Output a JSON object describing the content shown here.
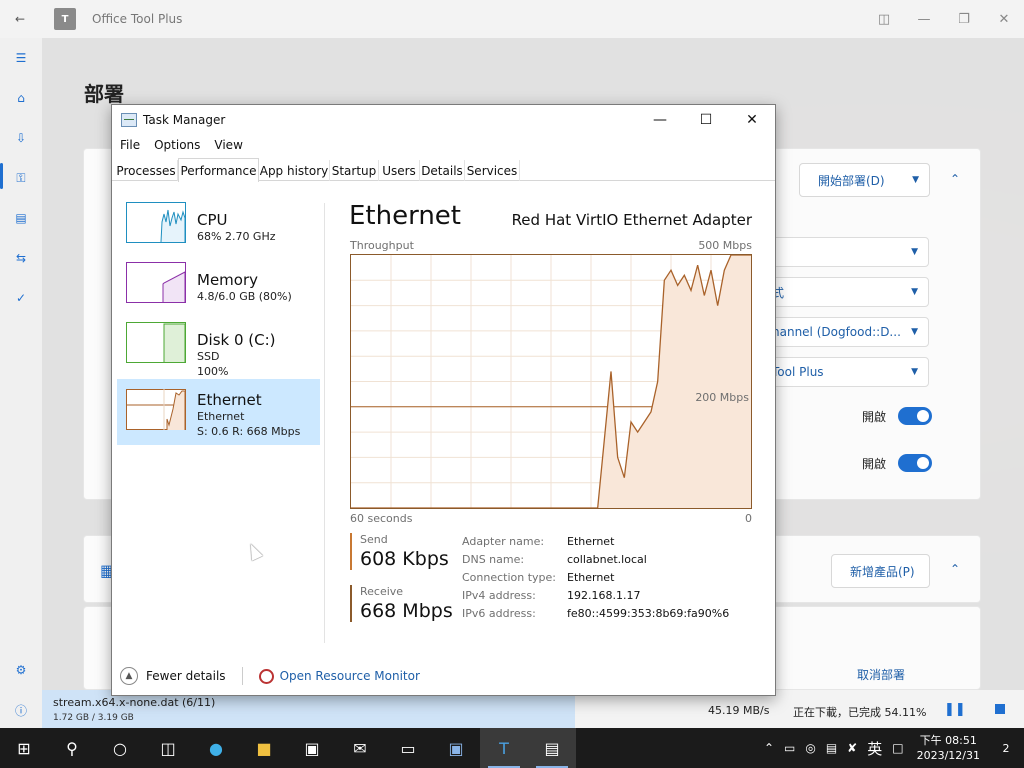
{
  "otp": {
    "title": "Office Tool Plus",
    "logo_text": "T",
    "heading": "部署",
    "deploy_button": "開始部署(D)",
    "dropdowns": [
      "",
      "式",
      "hannel (Dogfood::D...",
      "Tool Plus"
    ],
    "toggle_label": "開啟",
    "add_product_button": "新增產品(P)",
    "cancel_deploy": "取消部署",
    "status": {
      "file": "stream.x64.x-none.dat (6/11)",
      "size": "1.72 GB / 3.19 GB",
      "speed": "45.19 MB/s",
      "state": "正在下載，已完成 54.11%",
      "progress_fraction": 0.5411
    }
  },
  "taskmanager": {
    "title": "Task Manager",
    "menu": [
      "File",
      "Options",
      "View"
    ],
    "tabs": [
      "Processes",
      "Performance",
      "App history",
      "Startup",
      "Users",
      "Details",
      "Services"
    ],
    "selected_tab": "Performance",
    "sidebar": [
      {
        "name": "CPU",
        "line1": "68%  2.70 GHz",
        "line2": "",
        "color": "#1f8fc0"
      },
      {
        "name": "Memory",
        "line1": "4.8/6.0 GB (80%)",
        "line2": "",
        "color": "#8b2fa8"
      },
      {
        "name": "Disk 0 (C:)",
        "line1": "SSD",
        "line2": "100%",
        "color": "#4da835"
      },
      {
        "name": "Ethernet",
        "line1": "Ethernet",
        "line2": "S: 0.6  R: 668 Mbps",
        "color": "#a9622a"
      }
    ],
    "main": {
      "title": "Ethernet",
      "adapter": "Red Hat VirtIO Ethernet Adapter",
      "throughput_label": "Throughput",
      "max_label": "500 Mbps",
      "mid_label": "200 Mbps",
      "x_left_label": "60 seconds",
      "x_right_label": "0",
      "send_label": "Send",
      "send_value": "608 Kbps",
      "receive_label": "Receive",
      "receive_value": "668 Mbps",
      "details": [
        {
          "key": "Adapter name:",
          "value": "Ethernet"
        },
        {
          "key": "DNS name:",
          "value": "collabnet.local"
        },
        {
          "key": "Connection type:",
          "value": "Ethernet"
        },
        {
          "key": "IPv4 address:",
          "value": "192.168.1.17"
        },
        {
          "key": "IPv6 address:",
          "value": "fe80::4599:353:8b69:fa90%6"
        }
      ]
    },
    "footer": {
      "fewer_details": "Fewer details",
      "resource_monitor": "Open Resource Monitor"
    }
  },
  "chart_data": {
    "type": "area",
    "title": "Throughput",
    "x_label_left": "60 seconds",
    "x_label_right": "0",
    "xlim": [
      60,
      0
    ],
    "ylim": [
      0,
      500
    ],
    "y_labels": [
      "500 Mbps",
      "200 Mbps"
    ],
    "x": [
      60,
      42,
      23,
      21,
      20,
      19,
      18,
      17,
      16,
      15,
      14,
      13,
      12,
      11,
      10,
      9,
      8,
      7,
      6,
      5,
      4,
      3,
      2,
      1,
      0
    ],
    "values": [
      0,
      0,
      0,
      270,
      100,
      60,
      170,
      150,
      170,
      190,
      250,
      450,
      470,
      440,
      460,
      430,
      480,
      420,
      470,
      400,
      470,
      500,
      500,
      500,
      500
    ],
    "series": [
      {
        "name": "Receive",
        "color": "#a9622a"
      }
    ]
  },
  "taskbar": {
    "time": "下午 08:51",
    "date": "2023/12/31",
    "ime": "英",
    "notifications": "2"
  }
}
